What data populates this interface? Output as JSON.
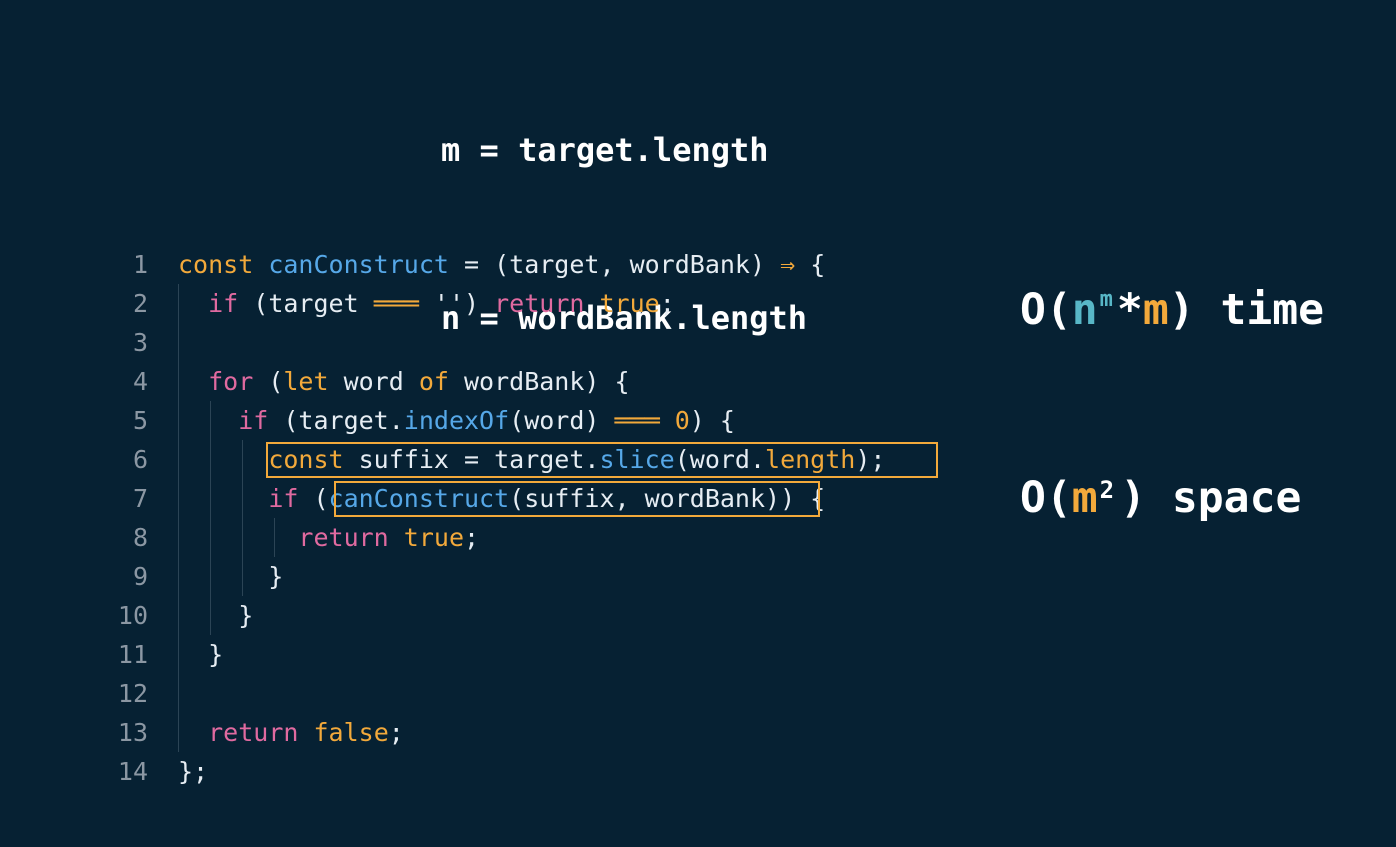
{
  "definitions": {
    "line1": "m = target.length",
    "line2": "n = wordBank.length"
  },
  "complexity": {
    "time_open": "O(",
    "time_n": "n",
    "time_sup": "m",
    "time_mul": "*",
    "time_m": "m",
    "time_close": ") time",
    "space_open": "O(",
    "space_m": "m",
    "space_sup": "2",
    "space_close": ") space"
  },
  "code": {
    "line_numbers": [
      "1",
      "2",
      "3",
      "4",
      "5",
      "6",
      "7",
      "8",
      "9",
      "10",
      "11",
      "12",
      "13",
      "14"
    ],
    "lines": [
      [
        {
          "t": "const ",
          "c": "kw-const"
        },
        {
          "t": "canConstruct",
          "c": "fn"
        },
        {
          "t": " = (",
          "c": "plain"
        },
        {
          "t": "target",
          "c": "plain"
        },
        {
          "t": ", ",
          "c": "plain"
        },
        {
          "t": "wordBank",
          "c": "plain"
        },
        {
          "t": ") ",
          "c": "plain"
        },
        {
          "t": "⇒",
          "c": "op"
        },
        {
          "t": " {",
          "c": "plain"
        }
      ],
      [
        {
          "t": "  ",
          "c": "plain"
        },
        {
          "t": "if",
          "c": "kw-pink"
        },
        {
          "t": " (",
          "c": "plain"
        },
        {
          "t": "target",
          "c": "plain"
        },
        {
          "t": " ",
          "c": "plain"
        },
        {
          "t": "═══",
          "c": "op"
        },
        {
          "t": " ''",
          "c": "str"
        },
        {
          "t": ") ",
          "c": "plain"
        },
        {
          "t": "return",
          "c": "kw-pink"
        },
        {
          "t": " ",
          "c": "plain"
        },
        {
          "t": "true",
          "c": "kw-bool"
        },
        {
          "t": ";",
          "c": "plain"
        }
      ],
      [
        {
          "t": "",
          "c": "plain"
        }
      ],
      [
        {
          "t": "  ",
          "c": "plain"
        },
        {
          "t": "for",
          "c": "kw-pink"
        },
        {
          "t": " (",
          "c": "plain"
        },
        {
          "t": "let",
          "c": "kw-const"
        },
        {
          "t": " word ",
          "c": "plain"
        },
        {
          "t": "of",
          "c": "kw-const"
        },
        {
          "t": " wordBank) {",
          "c": "plain"
        }
      ],
      [
        {
          "t": "    ",
          "c": "plain"
        },
        {
          "t": "if",
          "c": "kw-pink"
        },
        {
          "t": " (target.",
          "c": "plain"
        },
        {
          "t": "indexOf",
          "c": "fn"
        },
        {
          "t": "(word) ",
          "c": "plain"
        },
        {
          "t": "═══",
          "c": "op"
        },
        {
          "t": " ",
          "c": "plain"
        },
        {
          "t": "0",
          "c": "num"
        },
        {
          "t": ") {",
          "c": "plain"
        }
      ],
      [
        {
          "t": "      ",
          "c": "plain"
        },
        {
          "t": "const",
          "c": "kw-const"
        },
        {
          "t": " suffix = target.",
          "c": "plain"
        },
        {
          "t": "slice",
          "c": "fn"
        },
        {
          "t": "(word.",
          "c": "plain"
        },
        {
          "t": "length",
          "c": "kw-const"
        },
        {
          "t": ");",
          "c": "plain"
        }
      ],
      [
        {
          "t": "      ",
          "c": "plain"
        },
        {
          "t": "if",
          "c": "kw-pink"
        },
        {
          "t": " (",
          "c": "plain"
        },
        {
          "t": "canConstruct",
          "c": "fn"
        },
        {
          "t": "(suffix, wordBank)) {",
          "c": "plain"
        }
      ],
      [
        {
          "t": "        ",
          "c": "plain"
        },
        {
          "t": "return",
          "c": "kw-pink"
        },
        {
          "t": " ",
          "c": "plain"
        },
        {
          "t": "true",
          "c": "kw-bool"
        },
        {
          "t": ";",
          "c": "plain"
        }
      ],
      [
        {
          "t": "      }",
          "c": "plain"
        }
      ],
      [
        {
          "t": "    }",
          "c": "plain"
        }
      ],
      [
        {
          "t": "  }",
          "c": "plain"
        }
      ],
      [
        {
          "t": "",
          "c": "plain"
        }
      ],
      [
        {
          "t": "  ",
          "c": "plain"
        },
        {
          "t": "return",
          "c": "kw-pink"
        },
        {
          "t": " ",
          "c": "plain"
        },
        {
          "t": "false",
          "c": "kw-bool"
        },
        {
          "t": ";",
          "c": "plain"
        }
      ],
      [
        {
          "t": "};",
          "c": "plain"
        }
      ]
    ]
  },
  "colors": {
    "background": "#062133",
    "highlight": "#f2a93b",
    "keyword_pink": "#e06aa0",
    "keyword_orange": "#f2a93b",
    "function_blue": "#56a8e8",
    "n_teal": "#58b7c7"
  }
}
